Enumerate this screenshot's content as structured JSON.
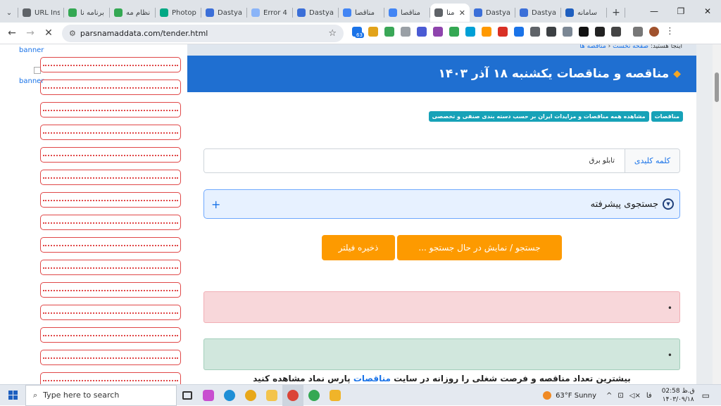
{
  "tabs": [
    {
      "title": "URL Ins",
      "color": "#5f6368"
    },
    {
      "title": "برنامه نا",
      "color": "#34a853"
    },
    {
      "title": "نظام مه",
      "color": "#34a853"
    },
    {
      "title": "Photop",
      "color": "#00a884"
    },
    {
      "title": "Dastya",
      "color": "#3b6fd8"
    },
    {
      "title": "Error 4",
      "color": "#8ab4f8"
    },
    {
      "title": "Dastya",
      "color": "#3b6fd8"
    },
    {
      "title": "مناقصا",
      "color": "#4285f4"
    },
    {
      "title": "مناقصا",
      "color": "#4285f4"
    },
    {
      "title": "منا",
      "color": "#5f6368",
      "active": true
    },
    {
      "title": "Dastya",
      "color": "#3b6fd8"
    },
    {
      "title": "Dastya",
      "color": "#3b6fd8"
    },
    {
      "title": "سامانه",
      "color": "#1f5fbf"
    }
  ],
  "browser": {
    "url": "parsnamaddata.com/tender.html",
    "ext_badge": "63"
  },
  "sidebar": {
    "banner1": "banner",
    "banner2": "banner"
  },
  "main": {
    "breadcrumb_prefix": "اینجا هستید:",
    "breadcrumb_home": "صفحه نخست",
    "breadcrumb_current": "مناقصه ها",
    "header_title": "مناقصه و مناقصات یکشنبه ۱۸ آذر ۱۴۰۳",
    "badge1": "مناقصات",
    "badge2": "مشاهده همه مناقصات و مزایدات ایران بر حسب دسته بندی صنفی و تخصصی",
    "keyword_label": "کلمه کلیدی",
    "keyword_value": "تابلو برق",
    "advanced_search": "جستجوی پیشرفته",
    "search_button": "جستجو / نمایش در حال جستجو ...",
    "save_filter_button": "ذخیره فیلتر",
    "bottom_text_a": "بیشترین تعداد مناقصه و فرصت شغلی را روزانه در سایت",
    "bottom_text_link": "مناقصات",
    "bottom_text_b": "پارس نماد مشاهده کنید"
  },
  "taskbar": {
    "search_placeholder": "Type here to search",
    "weather": "63°F  Sunny",
    "lang": "فا",
    "time": "ق.ظ 02:58",
    "date": "۱۴۰۳/۰۹/۱۸"
  }
}
